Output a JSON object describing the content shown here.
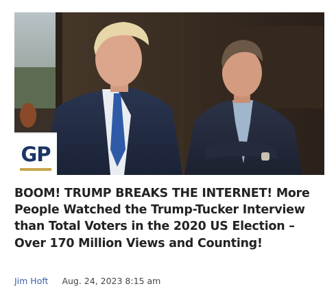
{
  "article": {
    "image_alt": "Two men standing outside a building",
    "logo_text": "GP",
    "headline": "BOOM! TRUMP BREAKS THE INTERNET! More People Watched the Trump-Tucker Interview than Total Voters in the 2020 US Election – Over 170 Million Views and Counting!",
    "author": "Jim Hoft",
    "date": "Aug. 24, 2023 8:15 am"
  },
  "colors": {
    "headline": "#222222",
    "author_link": "#3a5fa8",
    "date": "#444444",
    "logo_blue": "#1c3566",
    "logo_gold": "#c8a44a"
  }
}
